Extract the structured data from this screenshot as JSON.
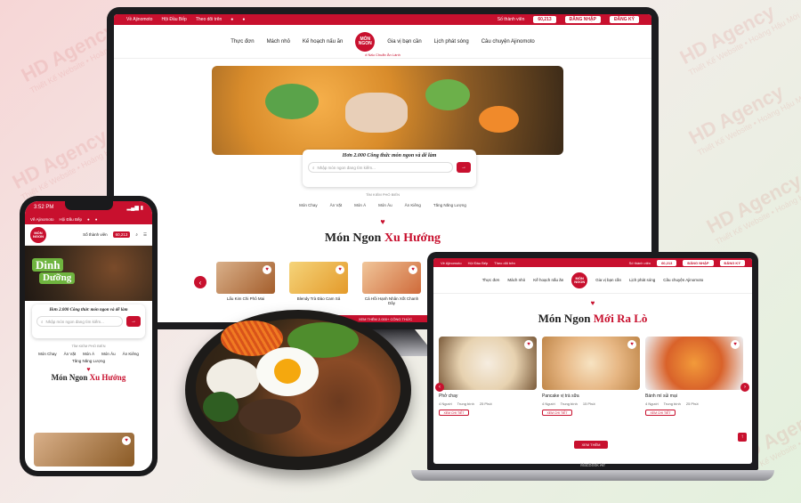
{
  "watermark": {
    "brand": "HD Agency",
    "slogan": "Thiết Kế Website • Hoàng Hậu Mới"
  },
  "colors": {
    "brand": "#c8102e",
    "green": "#6fb43f"
  },
  "desktop": {
    "topbar": {
      "link1": "Về Ajinomoto",
      "link2": "Hội Đầu Bếp",
      "follow": "Theo dõi trên",
      "members_label": "Số thành viên",
      "members": "60,213",
      "login": "ĐĂNG NHẬP",
      "register": "ĐĂNG KÝ"
    },
    "nav": {
      "left": [
        "Thực đơn",
        "Mách nhỏ",
        "Kế hoạch nấu ăn"
      ],
      "right": [
        "Gia vị bạn cần",
        "Lịch phát sóng",
        "Câu chuyện Ajinomoto"
      ],
      "logo": "MÓN NGON",
      "tagline": "# Nấu Chuẩn Ăn Lành"
    },
    "search": {
      "title": "Hơn 2.000 Công thức món ngon và dễ làm",
      "placeholder": "Nhập món ngon đang tìm kiếm..."
    },
    "popular_label": "TÌM KIẾM PHỔ BIẾN",
    "tags": [
      "Món Chay",
      "Ăn Vặt",
      "Món Á",
      "Món Âu",
      "Ăn Kiêng",
      "Tăng Năng Lượng"
    ],
    "section": {
      "title_black": "Món Ngon ",
      "title_red": "Xu Hướng"
    },
    "cards": [
      {
        "name": "Lẩu Kim Chi Phô Mai",
        "badge": "56"
      },
      {
        "name": "Blendy Trà Đào Cam Sả",
        "badge": "57"
      },
      {
        "name": "Cá Hồi Hạnh Nhân Xốt Chanh Dây",
        "badge": "37"
      }
    ],
    "cta": "XEM THÊM 2.000+ CÔNG THỨC"
  },
  "phone": {
    "time": "3:52 PM",
    "topbar": [
      "Về Ajinomoto",
      "Hội Đầu Bếp"
    ],
    "members_label": "Số thành viên",
    "members": "60,213",
    "hero_word1": "Dinh",
    "hero_word2": "Dưỡng",
    "search_title": "Hơn 2.000 Công thức món ngon và dễ làm",
    "search_placeholder": "Nhập món ngon đang tìm kiếm...",
    "popular_label": "TÌM KIẾM PHỔ BIẾN",
    "tags": [
      "Món Chay",
      "Ăn Vặt",
      "Món Á",
      "Món Âu",
      "Ăn Kiêng",
      "Tăng Năng Lượng"
    ],
    "section_black": "Món Ngon ",
    "section_red": "Xu Hướng"
  },
  "laptop": {
    "topbar": {
      "link1": "Về Ajinomoto",
      "link2": "Hội Đầu Bếp",
      "follow": "Theo dõi trên",
      "members_label": "Số thành viên",
      "members": "60,213",
      "login": "ĐĂNG NHẬP",
      "register": "ĐĂNG KÝ"
    },
    "nav": {
      "left": [
        "Thực đơn",
        "Mách nhỏ",
        "Kế hoạch nấu ăn"
      ],
      "right": [
        "Gia vị bạn cần",
        "Lịch phát sóng",
        "Câu chuyện Ajinomoto"
      ]
    },
    "section": {
      "title_black": "Món Ngon ",
      "title_red": "Mới Ra Lò"
    },
    "cards": [
      {
        "name": "Phở chay",
        "people": "4 Người",
        "level": "Trung bình",
        "time": "25 Phút",
        "btn": "XEM CHI TIẾT"
      },
      {
        "name": "Pancake vị trà sữa",
        "people": "4 Người",
        "level": "Trung bình",
        "time": "15 Phút",
        "btn": "XEM CHI TIẾT"
      },
      {
        "name": "Bánh mì sủi mại",
        "people": "4 Người",
        "level": "Trung bình",
        "time": "25 Phút",
        "btn": "XEM CHI TIẾT"
      }
    ],
    "more": "XEM THÊM",
    "model": "MacBook Air"
  }
}
